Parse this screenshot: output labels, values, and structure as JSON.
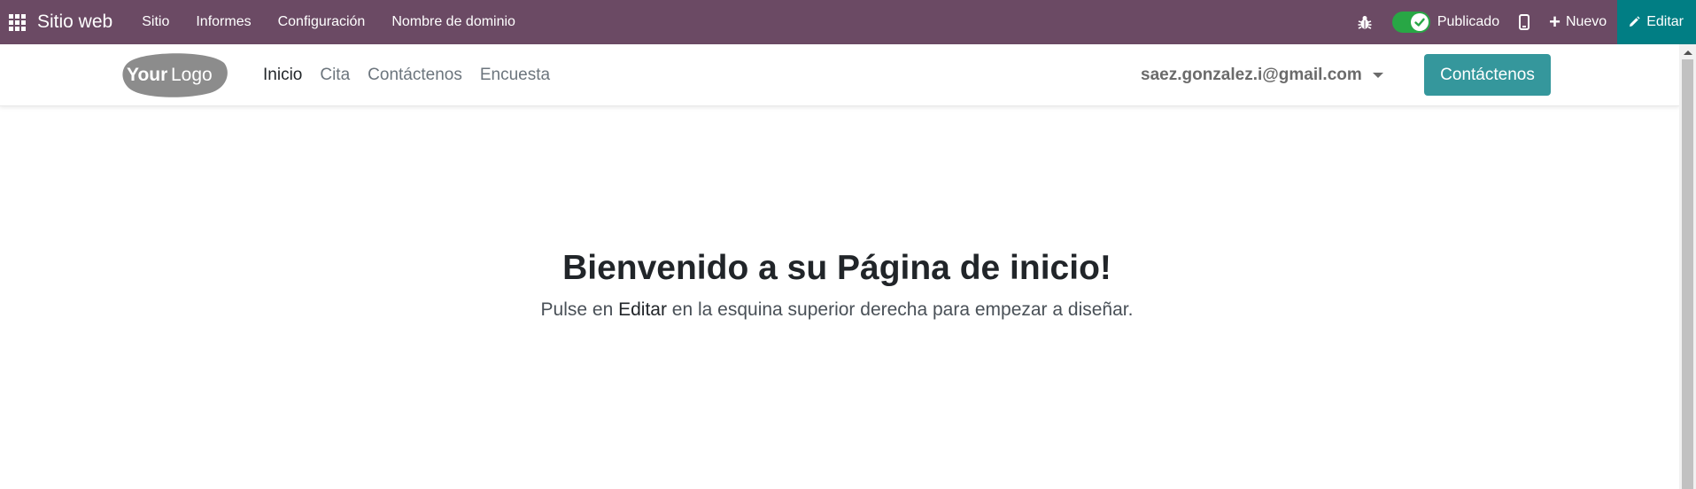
{
  "admin_bar": {
    "app_title": "Sitio web",
    "menu": [
      "Sitio",
      "Informes",
      "Configuración",
      "Nombre de dominio"
    ],
    "publish_label": "Publicado",
    "published": true,
    "new_label": "Nuevo",
    "edit_label": "Editar",
    "icons": [
      "apps-grid-icon",
      "bug-icon",
      "check-icon",
      "mobile-icon",
      "plus-icon",
      "pencil-icon"
    ],
    "colors": {
      "bar": "#6b4a64",
      "edit": "#017e84",
      "toggle": "#28a745"
    }
  },
  "site_header": {
    "logo_text": {
      "part1": "Your",
      "part2": "Logo"
    },
    "nav": [
      "Inicio",
      "Cita",
      "Contáctenos",
      "Encuesta"
    ],
    "active_nav": "Inicio",
    "user_email": "saez.gonzalez.i@gmail.com",
    "cta_label": "Contáctenos",
    "colors": {
      "cta": "#35979c"
    }
  },
  "hero": {
    "title_pre": "Bienvenido a su ",
    "title_strong": "Página de inicio",
    "title_post": "!",
    "sub_pre": "Pulse en ",
    "sub_strong": "Editar",
    "sub_post": " en la esquina superior derecha para empezar a diseñar."
  }
}
